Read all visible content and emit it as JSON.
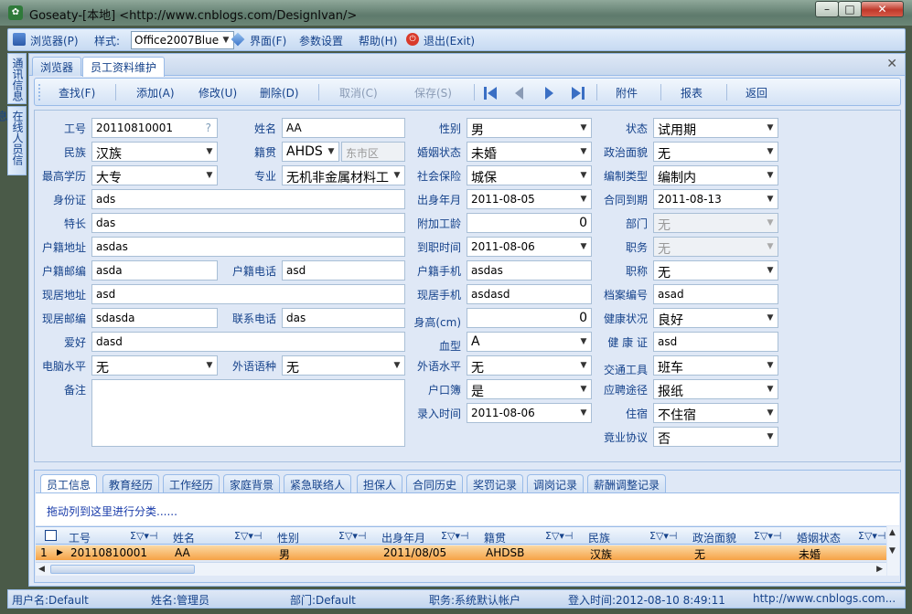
{
  "window": {
    "title": "Goseaty-[本地]    <http://www.cnblogs.com/DesignIvan/>",
    "minimize": "–",
    "maximize": "□",
    "close": "✕"
  },
  "menu": {
    "browser": "浏览器(P)",
    "style_label": "样式:",
    "style_value": "Office2007Blue",
    "ui": "界面(F)",
    "params": "参数设置",
    "help": "帮助(H)",
    "exit": "退出(Exit)"
  },
  "side_tabs": [
    "通讯信息",
    "在线人员信息"
  ],
  "tabs": [
    "浏览器",
    "员工资料维护"
  ],
  "toolbar": {
    "find": "查找(F)",
    "add": "添加(A)",
    "edit": "修改(U)",
    "delete": "删除(D)",
    "cancel": "取消(C)",
    "save": "保存(S)",
    "attach": "附件",
    "report": "报表",
    "back": "返回"
  },
  "form": {
    "emp_no": {
      "label": "工号",
      "value": "20110810001",
      "hint": "?"
    },
    "name": {
      "label": "姓名",
      "value": "AA"
    },
    "gender": {
      "label": "性别",
      "value": "男"
    },
    "status": {
      "label": "状态",
      "value": "试用期"
    },
    "ethnic": {
      "label": "民族",
      "value": "汉族"
    },
    "native": {
      "label": "籍贯",
      "value": "AHDS",
      "district": "东市区"
    },
    "marital": {
      "label": "婚姻状态",
      "value": "未婚"
    },
    "political": {
      "label": "政治面貌",
      "value": "无"
    },
    "education": {
      "label": "最高学历",
      "value": "大专"
    },
    "major": {
      "label": "专业",
      "value": "无机非金属材料工"
    },
    "insurance": {
      "label": "社会保险",
      "value": "城保"
    },
    "staffing": {
      "label": "编制类型",
      "value": "编制内"
    },
    "id_card": {
      "label": "身份证",
      "value": "ads"
    },
    "birth": {
      "label": "出身年月",
      "value": "2011-08-05"
    },
    "contract_end": {
      "label": "合同到期",
      "value": "2011-08-13"
    },
    "specialty": {
      "label": "特长",
      "value": "das"
    },
    "extra_years": {
      "label": "附加工龄",
      "value": "0"
    },
    "dept": {
      "label": "部门",
      "value": "无"
    },
    "hukou_addr": {
      "label": "户籍地址",
      "value": "asdas"
    },
    "join_date": {
      "label": "到职时间",
      "value": "2011-08-06"
    },
    "position": {
      "label": "职务",
      "value": "无"
    },
    "hukou_zip": {
      "label": "户籍邮编",
      "value": "asda"
    },
    "hukou_tel": {
      "label": "户籍电话",
      "value": "asd"
    },
    "hukou_mobile": {
      "label": "户籍手机",
      "value": "asdas"
    },
    "title": {
      "label": "职称",
      "value": "无"
    },
    "cur_addr": {
      "label": "现居地址",
      "value": "asd"
    },
    "cur_mobile": {
      "label": "现居手机",
      "value": "asdasd"
    },
    "archive_no": {
      "label": "档案编号",
      "value": "asad"
    },
    "cur_zip": {
      "label": "现居邮编",
      "value": "sdasda"
    },
    "contact_tel": {
      "label": "联系电话",
      "value": "das"
    },
    "height": {
      "label": "身高(cm)",
      "value": "0"
    },
    "health": {
      "label": "健康状况",
      "value": "良好"
    },
    "hobby": {
      "label": "爱好",
      "value": "dasd"
    },
    "blood": {
      "label": "血型",
      "value": "A"
    },
    "health_cert": {
      "label": "健 康 证",
      "value": "asd"
    },
    "computer": {
      "label": "电脑水平",
      "value": "无"
    },
    "foreign_lang": {
      "label": "外语语种",
      "value": "无"
    },
    "lang_level": {
      "label": "外语水平",
      "value": "无"
    },
    "transport": {
      "label": "交通工具",
      "value": "班车"
    },
    "remark": {
      "label": "备注",
      "value": ""
    },
    "hukou_in": {
      "label": "户口簿",
      "value": "是"
    },
    "channel": {
      "label": "应聘途径",
      "value": "报纸"
    },
    "entry_time": {
      "label": "录入时间",
      "value": "2011-08-06"
    },
    "lodging": {
      "label": "住宿",
      "value": "不住宿"
    },
    "noncompete": {
      "label": "竟业协议",
      "value": "否"
    }
  },
  "sub_tabs": [
    "员工信息",
    "教育经历",
    "工作经历",
    "家庭背景",
    "紧急联络人",
    "担保人",
    "合同历史",
    "奖罚记录",
    "调岗记录",
    "薪酬调整记录"
  ],
  "grid": {
    "group_hint": "拖动列到这里进行分类......",
    "filter_symbols": "Σ▽▾⊣",
    "columns": [
      "工号",
      "姓名",
      "性别",
      "出身年月",
      "籍贯",
      "民族",
      "政治面貌",
      "婚姻状态"
    ],
    "rows": [
      {
        "num": "1",
        "cells": [
          "20110810001",
          "AA",
          "男",
          "2011/08/05",
          "AHDSB",
          "汉族",
          "无",
          "未婚"
        ]
      }
    ]
  },
  "status": {
    "user": "用户名:Default",
    "name": "姓名:管理员",
    "dept": "部门:Default",
    "post": "职务:系统默认帐户",
    "login": "登入时间:2012-08-10 8:49:11",
    "site": "http://www.cnblogs.com..."
  }
}
